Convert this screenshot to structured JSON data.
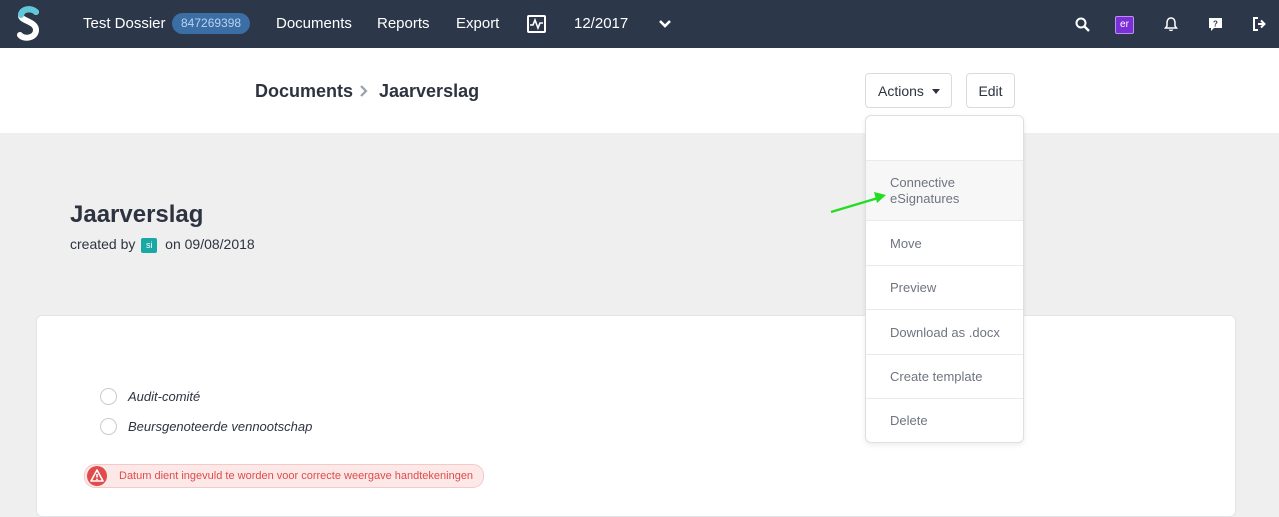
{
  "nav": {
    "dossier_name": "Test Dossier",
    "dossier_id": "847269398",
    "documents": "Documents",
    "reports": "Reports",
    "export": "Export",
    "period": "12/2017",
    "user_initials": "er",
    "icons": [
      "logo",
      "activity-icon",
      "chevron-down-icon",
      "search-icon",
      "bell-icon",
      "help-icon",
      "logout-icon"
    ]
  },
  "breadcrumb": {
    "parent": "Documents",
    "current": "Jaarverslag"
  },
  "toolbar": {
    "actions_label": "Actions",
    "edit_label": "Edit"
  },
  "actions_menu": {
    "items": [
      "Connective eSignatures",
      "Move",
      "Preview",
      "Download as .docx",
      "Create template",
      "Delete"
    ]
  },
  "document": {
    "title": "Jaarverslag",
    "created_prefix": "created by",
    "creator_initials": "si",
    "created_date": "on 09/08/2018"
  },
  "form": {
    "options": [
      "Audit-comité",
      "Beursgenoteerde vennootschap"
    ],
    "warning": "Datum dient ingevuld te worden voor correcte weergave handtekeningen"
  },
  "colors": {
    "nav_bg": "#2c3749",
    "accent": "#3b6ea5",
    "warning": "#e04b4b",
    "annotation_arrow": "#22dd22"
  }
}
